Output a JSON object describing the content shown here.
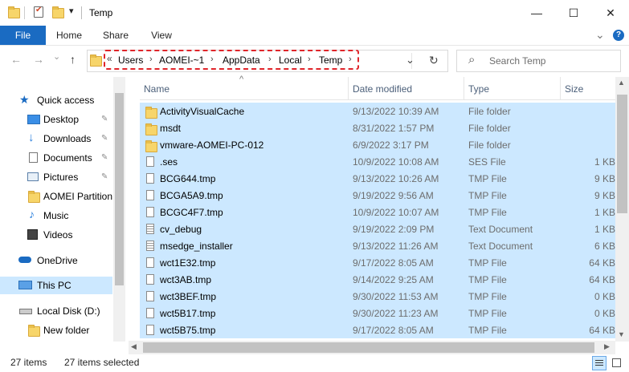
{
  "window": {
    "title": "Temp",
    "minimize_glyph": "—",
    "maximize_glyph": "☐",
    "close_glyph": "✕",
    "dropdown_glyph": "▾"
  },
  "ribbon": {
    "tabs": [
      {
        "label": "File"
      },
      {
        "label": "Home"
      },
      {
        "label": "Share"
      },
      {
        "label": "View"
      }
    ],
    "expand_glyph": "⌄",
    "help_glyph": "?"
  },
  "nav": {
    "back_glyph": "←",
    "forward_glyph": "→",
    "recent_glyph": "⌄",
    "up_glyph": "↑",
    "overflow_glyph": "«",
    "breadcrumbs": [
      "Users",
      "AOMEI-~1",
      "AppData",
      "Local",
      "Temp"
    ],
    "crumb_sep": "›",
    "address_dropdown_glyph": "⌄",
    "refresh_glyph": "↻",
    "search_placeholder": "Search Temp",
    "search_icon": "⌕"
  },
  "sidebar": {
    "items": [
      {
        "label": "Quick access",
        "icon": "star-icon",
        "pinned": false
      },
      {
        "label": "Desktop",
        "icon": "desktop-icon",
        "pinned": true
      },
      {
        "label": "Downloads",
        "icon": "download-icon",
        "pinned": true
      },
      {
        "label": "Documents",
        "icon": "documents-icon",
        "pinned": true
      },
      {
        "label": "Pictures",
        "icon": "pictures-icon",
        "pinned": true
      },
      {
        "label": "AOMEI Partition",
        "icon": "folder-icon",
        "pinned": false
      },
      {
        "label": "Music",
        "icon": "music-icon",
        "pinned": false
      },
      {
        "label": "Videos",
        "icon": "videos-icon",
        "pinned": false
      },
      {
        "label": "OneDrive",
        "icon": "cloud-icon",
        "pinned": false
      },
      {
        "label": "This PC",
        "icon": "computer-icon",
        "pinned": false
      },
      {
        "label": "Local Disk (D:)",
        "icon": "drive-icon",
        "pinned": false
      },
      {
        "label": "New folder",
        "icon": "folder-icon",
        "pinned": false
      }
    ],
    "pin_glyph": "📌"
  },
  "columns": {
    "name": "Name",
    "date": "Date modified",
    "type": "Type",
    "size": "Size",
    "sort_glyph": "^"
  },
  "files": [
    {
      "name": "ActivityVisualCache",
      "date": "9/13/2022 10:39 AM",
      "type": "File folder",
      "size": "",
      "icon": "folder-icon"
    },
    {
      "name": "msdt",
      "date": "8/31/2022 1:57 PM",
      "type": "File folder",
      "size": "",
      "icon": "folder-icon"
    },
    {
      "name": "vmware-AOMEI-PC-012",
      "date": "6/9/2022 3:17 PM",
      "type": "File folder",
      "size": "",
      "icon": "folder-icon"
    },
    {
      "name": ".ses",
      "date": "10/9/2022 10:08 AM",
      "type": "SES File",
      "size": "1 KB",
      "icon": "file-icon"
    },
    {
      "name": "BCG644.tmp",
      "date": "9/13/2022 10:26 AM",
      "type": "TMP File",
      "size": "9 KB",
      "icon": "file-icon"
    },
    {
      "name": "BCGA5A9.tmp",
      "date": "9/19/2022 9:56 AM",
      "type": "TMP File",
      "size": "9 KB",
      "icon": "file-icon"
    },
    {
      "name": "BCGC4F7.tmp",
      "date": "10/9/2022 10:07 AM",
      "type": "TMP File",
      "size": "1 KB",
      "icon": "file-icon"
    },
    {
      "name": "cv_debug",
      "date": "9/19/2022 2:09 PM",
      "type": "Text Document",
      "size": "1 KB",
      "icon": "text-file-icon"
    },
    {
      "name": "msedge_installer",
      "date": "9/13/2022 11:26 AM",
      "type": "Text Document",
      "size": "6 KB",
      "icon": "text-file-icon"
    },
    {
      "name": "wct1E32.tmp",
      "date": "9/17/2022 8:05 AM",
      "type": "TMP File",
      "size": "64 KB",
      "icon": "file-icon"
    },
    {
      "name": "wct3AB.tmp",
      "date": "9/14/2022 9:25 AM",
      "type": "TMP File",
      "size": "64 KB",
      "icon": "file-icon"
    },
    {
      "name": "wct3BEF.tmp",
      "date": "9/30/2022 11:53 AM",
      "type": "TMP File",
      "size": "0 KB",
      "icon": "file-icon"
    },
    {
      "name": "wct5B17.tmp",
      "date": "9/30/2022 11:23 AM",
      "type": "TMP File",
      "size": "0 KB",
      "icon": "file-icon"
    },
    {
      "name": "wct5B75.tmp",
      "date": "9/17/2022 8:05 AM",
      "type": "TMP File",
      "size": "64 KB",
      "icon": "file-icon"
    }
  ],
  "status": {
    "item_count": "27 items",
    "selected_count": "27 items selected"
  },
  "colors": {
    "selection": "#cce8ff",
    "file_tab": "#1a6bc2",
    "highlight_border": "#e0252a",
    "folder": "#f7d56a"
  }
}
